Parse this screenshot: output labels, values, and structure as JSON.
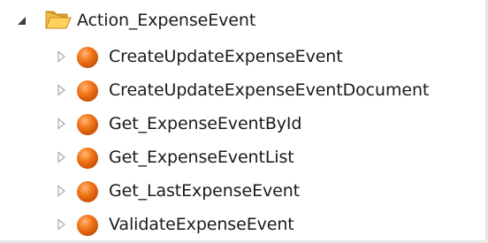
{
  "tree": {
    "root": {
      "label": "Action_ExpenseEvent",
      "expanded": true,
      "icon": "folder-open-icon",
      "icon_color": "#f2b632"
    },
    "children": [
      {
        "label": "CreateUpdateExpenseEvent",
        "icon": "orange-ball-icon"
      },
      {
        "label": "CreateUpdateExpenseEventDocument",
        "icon": "orange-ball-icon"
      },
      {
        "label": "Get_ExpenseEventById",
        "icon": "orange-ball-icon"
      },
      {
        "label": "Get_ExpenseEventList",
        "icon": "orange-ball-icon"
      },
      {
        "label": "Get_LastExpenseEvent",
        "icon": "orange-ball-icon"
      },
      {
        "label": "ValidateExpenseEvent",
        "icon": "orange-ball-icon"
      }
    ],
    "child_icon_color": "#f07a1a",
    "collapsed_expander_color": "#a8a8a8",
    "expanded_expander_color": "#3c3c3c"
  }
}
